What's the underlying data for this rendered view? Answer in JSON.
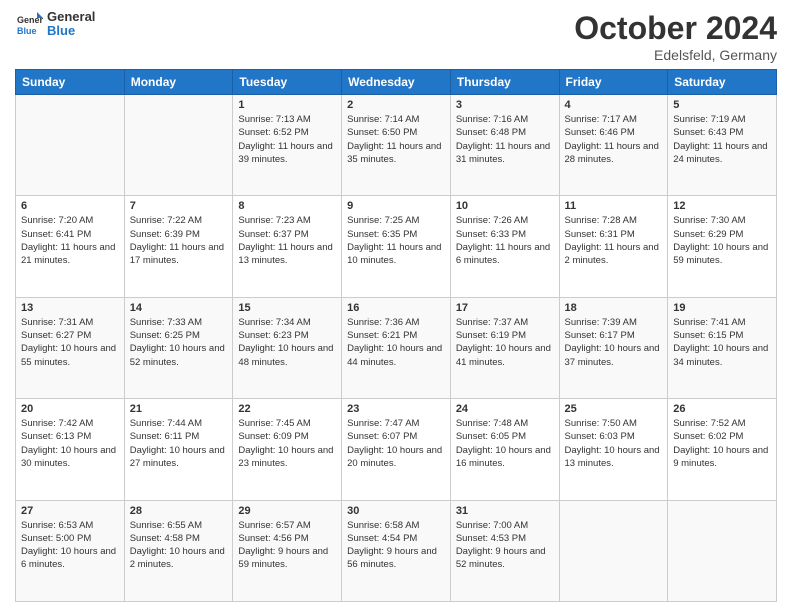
{
  "header": {
    "logo_line1": "General",
    "logo_line2": "Blue",
    "month": "October 2024",
    "location": "Edelsfeld, Germany"
  },
  "weekdays": [
    "Sunday",
    "Monday",
    "Tuesday",
    "Wednesday",
    "Thursday",
    "Friday",
    "Saturday"
  ],
  "weeks": [
    [
      {
        "day": "",
        "info": ""
      },
      {
        "day": "",
        "info": ""
      },
      {
        "day": "1",
        "info": "Sunrise: 7:13 AM\nSunset: 6:52 PM\nDaylight: 11 hours and 39 minutes."
      },
      {
        "day": "2",
        "info": "Sunrise: 7:14 AM\nSunset: 6:50 PM\nDaylight: 11 hours and 35 minutes."
      },
      {
        "day": "3",
        "info": "Sunrise: 7:16 AM\nSunset: 6:48 PM\nDaylight: 11 hours and 31 minutes."
      },
      {
        "day": "4",
        "info": "Sunrise: 7:17 AM\nSunset: 6:46 PM\nDaylight: 11 hours and 28 minutes."
      },
      {
        "day": "5",
        "info": "Sunrise: 7:19 AM\nSunset: 6:43 PM\nDaylight: 11 hours and 24 minutes."
      }
    ],
    [
      {
        "day": "6",
        "info": "Sunrise: 7:20 AM\nSunset: 6:41 PM\nDaylight: 11 hours and 21 minutes."
      },
      {
        "day": "7",
        "info": "Sunrise: 7:22 AM\nSunset: 6:39 PM\nDaylight: 11 hours and 17 minutes."
      },
      {
        "day": "8",
        "info": "Sunrise: 7:23 AM\nSunset: 6:37 PM\nDaylight: 11 hours and 13 minutes."
      },
      {
        "day": "9",
        "info": "Sunrise: 7:25 AM\nSunset: 6:35 PM\nDaylight: 11 hours and 10 minutes."
      },
      {
        "day": "10",
        "info": "Sunrise: 7:26 AM\nSunset: 6:33 PM\nDaylight: 11 hours and 6 minutes."
      },
      {
        "day": "11",
        "info": "Sunrise: 7:28 AM\nSunset: 6:31 PM\nDaylight: 11 hours and 2 minutes."
      },
      {
        "day": "12",
        "info": "Sunrise: 7:30 AM\nSunset: 6:29 PM\nDaylight: 10 hours and 59 minutes."
      }
    ],
    [
      {
        "day": "13",
        "info": "Sunrise: 7:31 AM\nSunset: 6:27 PM\nDaylight: 10 hours and 55 minutes."
      },
      {
        "day": "14",
        "info": "Sunrise: 7:33 AM\nSunset: 6:25 PM\nDaylight: 10 hours and 52 minutes."
      },
      {
        "day": "15",
        "info": "Sunrise: 7:34 AM\nSunset: 6:23 PM\nDaylight: 10 hours and 48 minutes."
      },
      {
        "day": "16",
        "info": "Sunrise: 7:36 AM\nSunset: 6:21 PM\nDaylight: 10 hours and 44 minutes."
      },
      {
        "day": "17",
        "info": "Sunrise: 7:37 AM\nSunset: 6:19 PM\nDaylight: 10 hours and 41 minutes."
      },
      {
        "day": "18",
        "info": "Sunrise: 7:39 AM\nSunset: 6:17 PM\nDaylight: 10 hours and 37 minutes."
      },
      {
        "day": "19",
        "info": "Sunrise: 7:41 AM\nSunset: 6:15 PM\nDaylight: 10 hours and 34 minutes."
      }
    ],
    [
      {
        "day": "20",
        "info": "Sunrise: 7:42 AM\nSunset: 6:13 PM\nDaylight: 10 hours and 30 minutes."
      },
      {
        "day": "21",
        "info": "Sunrise: 7:44 AM\nSunset: 6:11 PM\nDaylight: 10 hours and 27 minutes."
      },
      {
        "day": "22",
        "info": "Sunrise: 7:45 AM\nSunset: 6:09 PM\nDaylight: 10 hours and 23 minutes."
      },
      {
        "day": "23",
        "info": "Sunrise: 7:47 AM\nSunset: 6:07 PM\nDaylight: 10 hours and 20 minutes."
      },
      {
        "day": "24",
        "info": "Sunrise: 7:48 AM\nSunset: 6:05 PM\nDaylight: 10 hours and 16 minutes."
      },
      {
        "day": "25",
        "info": "Sunrise: 7:50 AM\nSunset: 6:03 PM\nDaylight: 10 hours and 13 minutes."
      },
      {
        "day": "26",
        "info": "Sunrise: 7:52 AM\nSunset: 6:02 PM\nDaylight: 10 hours and 9 minutes."
      }
    ],
    [
      {
        "day": "27",
        "info": "Sunrise: 6:53 AM\nSunset: 5:00 PM\nDaylight: 10 hours and 6 minutes."
      },
      {
        "day": "28",
        "info": "Sunrise: 6:55 AM\nSunset: 4:58 PM\nDaylight: 10 hours and 2 minutes."
      },
      {
        "day": "29",
        "info": "Sunrise: 6:57 AM\nSunset: 4:56 PM\nDaylight: 9 hours and 59 minutes."
      },
      {
        "day": "30",
        "info": "Sunrise: 6:58 AM\nSunset: 4:54 PM\nDaylight: 9 hours and 56 minutes."
      },
      {
        "day": "31",
        "info": "Sunrise: 7:00 AM\nSunset: 4:53 PM\nDaylight: 9 hours and 52 minutes."
      },
      {
        "day": "",
        "info": ""
      },
      {
        "day": "",
        "info": ""
      }
    ]
  ]
}
